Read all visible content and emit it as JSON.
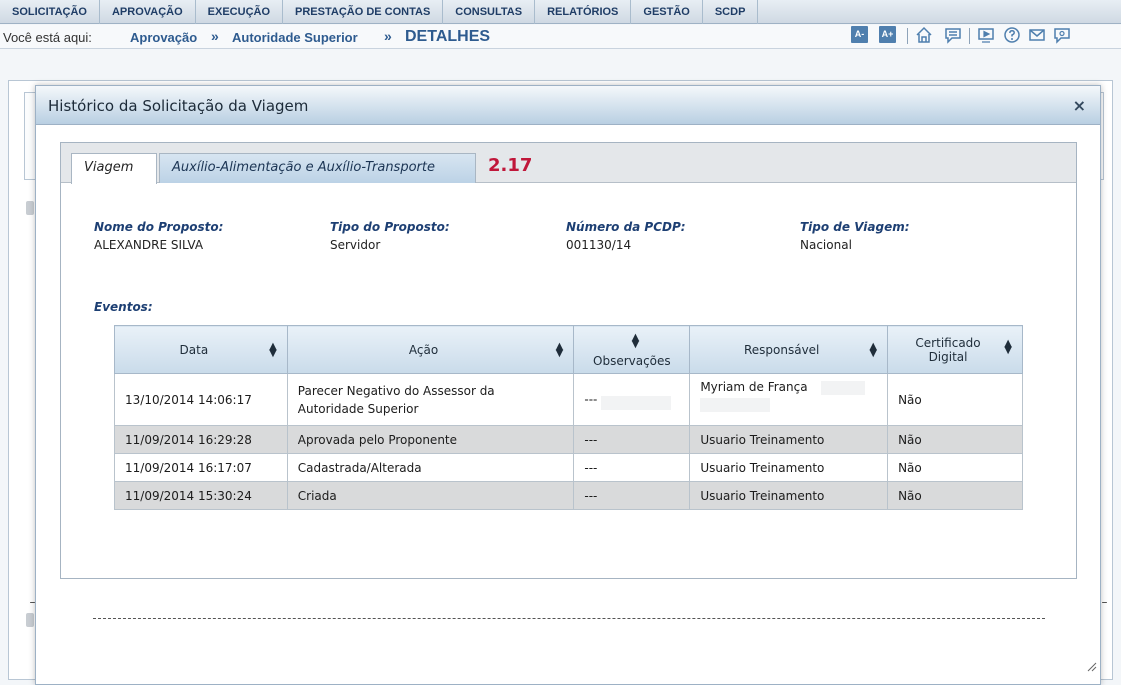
{
  "menu": {
    "items": [
      "SOLICITAÇÃO",
      "APROVAÇÃO",
      "EXECUÇÃO",
      "PRESTAÇÃO DE CONTAS",
      "CONSULTAS",
      "RELATÓRIOS",
      "GESTÃO",
      "SCDP"
    ]
  },
  "breadcrumb": {
    "prefix": "Você está aqui:",
    "level1": "Aprovação",
    "level2": "Autoridade Superior",
    "level3": "DETALHES",
    "separator": "»"
  },
  "toolbar": {
    "font_decrease": "A-",
    "font_increase": "A+",
    "icons": [
      "home-icon",
      "chat-icon",
      "video-icon",
      "help-icon",
      "mail-icon",
      "contact-icon"
    ]
  },
  "modal": {
    "title": "Histórico da Solicitação da Viagem",
    "close_symbol": "×",
    "tabs": [
      {
        "label": "Viagem",
        "active": true
      },
      {
        "label": "Auxílio-Alimentação e Auxílio-Transporte",
        "active": false
      }
    ],
    "version": "2.17",
    "info": {
      "nome_proposto_label": "Nome do Proposto:",
      "nome_proposto_value": "ALEXANDRE SILVA",
      "tipo_proposto_label": "Tipo do Proposto:",
      "tipo_proposto_value": "Servidor",
      "numero_pcdp_label": "Número da PCDP:",
      "numero_pcdp_value": "001130/14",
      "tipo_viagem_label": "Tipo de Viagem:",
      "tipo_viagem_value": "Nacional"
    },
    "eventos_label": "Eventos:",
    "table": {
      "headers": {
        "data": "Data",
        "acao": "Ação",
        "observacoes": "Observações",
        "responsavel": "Responsável",
        "certificado_line1": "Certificado",
        "certificado_line2": "Digital"
      },
      "rows": [
        {
          "data": "13/10/2014 14:06:17",
          "acao_line1": "Parecer Negativo do Assessor da",
          "acao_line2": "Autoridade Superior",
          "obs": "---",
          "responsavel": "Myriam de França",
          "certificado": "Não"
        },
        {
          "data": "11/09/2014 16:29:28",
          "acao_line1": "Aprovada pelo Proponente",
          "obs": "---",
          "responsavel": "Usuario Treinamento",
          "certificado": "Não"
        },
        {
          "data": "11/09/2014 16:17:07",
          "acao_line1": "Cadastrada/Alterada",
          "obs": "---",
          "responsavel": "Usuario Treinamento",
          "certificado": "Não"
        },
        {
          "data": "11/09/2014 15:30:24",
          "acao_line1": "Criada",
          "obs": "---",
          "responsavel": "Usuario Treinamento",
          "certificado": "Não"
        }
      ]
    }
  },
  "colors": {
    "link_blue": "#2e5b8f",
    "label_blue": "#1d3f73",
    "version_red": "#c0173a",
    "row_alt": "#d9dadb"
  }
}
